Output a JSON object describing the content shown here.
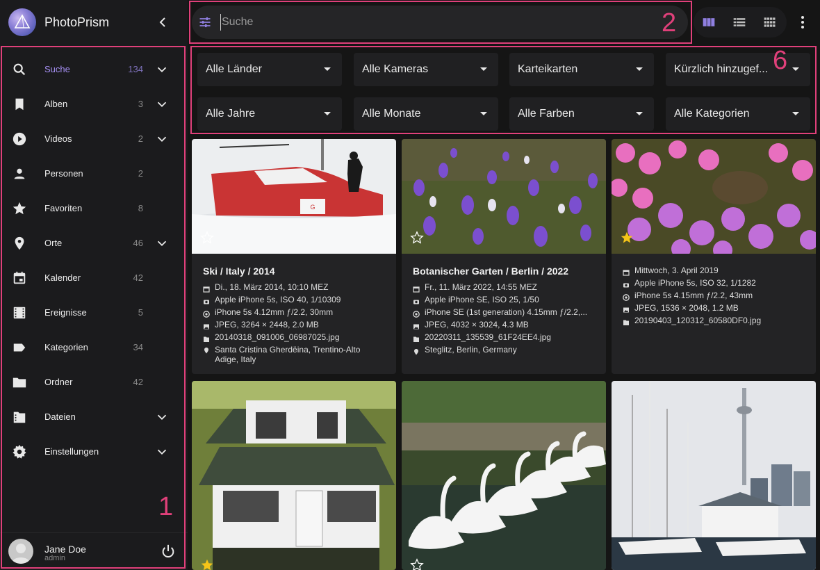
{
  "app": {
    "name": "PhotoPrism"
  },
  "sidebar": {
    "items": [
      {
        "label": "Suche",
        "count": "134",
        "icon": "search-icon",
        "chevron": true,
        "active": true
      },
      {
        "label": "Alben",
        "count": "3",
        "icon": "bookmark-icon",
        "chevron": true
      },
      {
        "label": "Videos",
        "count": "2",
        "icon": "play-circle-icon",
        "chevron": true
      },
      {
        "label": "Personen",
        "count": "2",
        "icon": "person-icon",
        "chevron": false
      },
      {
        "label": "Favoriten",
        "count": "8",
        "icon": "star-icon",
        "chevron": false
      },
      {
        "label": "Orte",
        "count": "46",
        "icon": "place-icon",
        "chevron": true
      },
      {
        "label": "Kalender",
        "count": "42",
        "icon": "calendar-icon",
        "chevron": false
      },
      {
        "label": "Ereignisse",
        "count": "5",
        "icon": "film-icon",
        "chevron": false
      },
      {
        "label": "Kategorien",
        "count": "34",
        "icon": "label-icon",
        "chevron": false
      },
      {
        "label": "Ordner",
        "count": "42",
        "icon": "folder-icon",
        "chevron": false
      },
      {
        "label": "Dateien",
        "count": "",
        "icon": "file-icon",
        "chevron": true
      },
      {
        "label": "Einstellungen",
        "count": "",
        "icon": "gear-icon",
        "chevron": true
      }
    ],
    "user": {
      "name": "Jane Doe",
      "role": "admin"
    }
  },
  "search": {
    "placeholder": "Suche"
  },
  "filters": [
    "Alle Länder",
    "Alle Kameras",
    "Karteikarten",
    "Kürzlich hinzugef...",
    "Alle Jahre",
    "Alle Monate",
    "Alle Farben",
    "Alle Kategorien"
  ],
  "annotations": {
    "sidebar": "1",
    "search": "2",
    "filters": "6"
  },
  "cards": [
    {
      "title": "Ski / Italy / 2014",
      "favorite": false,
      "meta": [
        {
          "icon": "calendar-icon",
          "text": "Di., 18. März 2014, 10:10 MEZ"
        },
        {
          "icon": "camera-icon",
          "text": "Apple iPhone 5s, ISO 40, 1/10309"
        },
        {
          "icon": "lens-icon",
          "text": "iPhone 5s 4.12mm ƒ/2.2, 30mm"
        },
        {
          "icon": "image-icon",
          "text": "JPEG, 3264 × 2448, 2.0 MB"
        },
        {
          "icon": "file-icon",
          "text": "20140318_091006_06987025.jpg"
        },
        {
          "icon": "place-icon",
          "text": "Santa Cristina Gherdëina, Trentino-Alto Adige, Italy"
        }
      ]
    },
    {
      "title": "Botanischer Garten / Berlin / 2022",
      "favorite": false,
      "meta": [
        {
          "icon": "calendar-icon",
          "text": "Fr., 11. März 2022, 14:55 MEZ"
        },
        {
          "icon": "camera-icon",
          "text": "Apple iPhone SE, ISO 25, 1/50"
        },
        {
          "icon": "lens-icon",
          "text": "iPhone SE (1st generation) 4.15mm ƒ/2.2,..."
        },
        {
          "icon": "image-icon",
          "text": "JPEG, 4032 × 3024, 4.3 MB"
        },
        {
          "icon": "file-icon",
          "text": "20220311_135539_61F24EE4.jpg"
        },
        {
          "icon": "place-icon",
          "text": "Steglitz, Berlin, Germany"
        }
      ]
    },
    {
      "title": "",
      "favorite": true,
      "meta": [
        {
          "icon": "calendar-icon",
          "text": "Mittwoch, 3. April 2019"
        },
        {
          "icon": "camera-icon",
          "text": "Apple iPhone 5s, ISO 32, 1/1282"
        },
        {
          "icon": "lens-icon",
          "text": "iPhone 5s 4.15mm ƒ/2.2, 43mm"
        },
        {
          "icon": "image-icon",
          "text": "JPEG, 1536 × 2048, 1.2 MB"
        },
        {
          "icon": "file-icon",
          "text": "20190403_120312_60580DF0.jpg"
        }
      ]
    },
    {
      "title": "",
      "favorite": true,
      "meta": []
    },
    {
      "title": "",
      "favorite": false,
      "meta": []
    },
    {
      "title": "",
      "favorite": false,
      "meta": []
    }
  ],
  "colors": {
    "accent": "#a58ff2",
    "annotation": "#e0407a",
    "favorite": "#f5c518"
  }
}
